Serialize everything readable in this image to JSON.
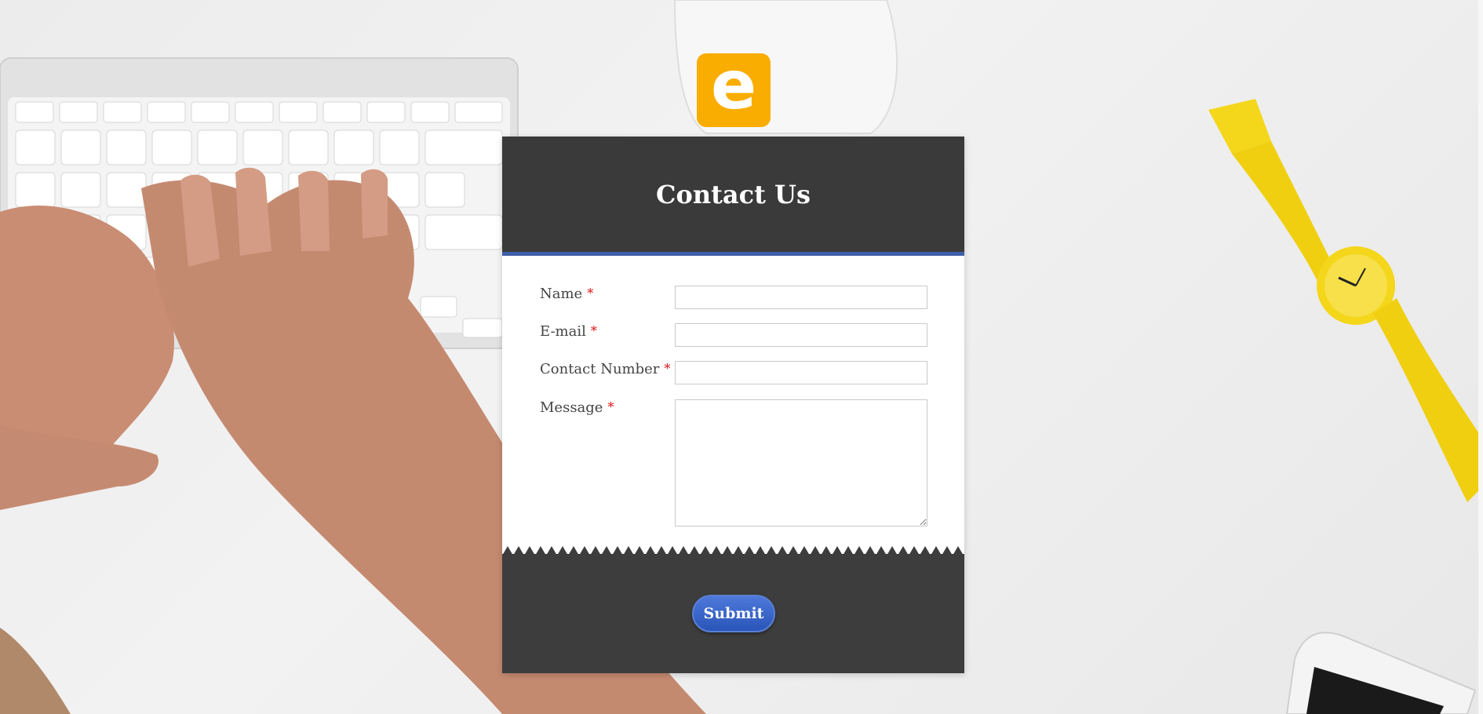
{
  "logo": {
    "letter": "e",
    "color": "#f9ad00"
  },
  "form": {
    "title": "Contact Us",
    "required_mark": "*",
    "fields": [
      {
        "label": "Name",
        "value": ""
      },
      {
        "label": "E-mail",
        "value": ""
      },
      {
        "label": "Contact Number",
        "value": ""
      },
      {
        "label": "Message",
        "value": ""
      }
    ],
    "submit_label": "Submit"
  },
  "colors": {
    "header_bg": "#3a3a3a",
    "header_border": "#3e5ea8",
    "footer_bg": "#3d3d3d",
    "required": "#dd1111",
    "submit": "#2f5cc4"
  }
}
